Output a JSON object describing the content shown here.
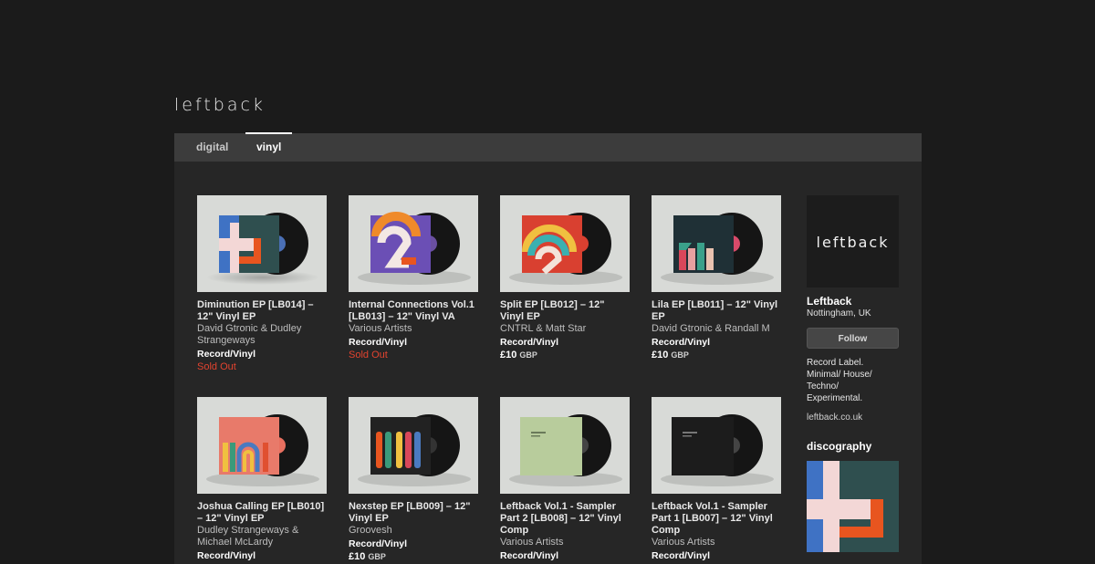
{
  "header": {
    "logo": "leftback"
  },
  "nav": {
    "tabs": [
      {
        "label": "digital"
      },
      {
        "label": "vinyl"
      }
    ]
  },
  "releases": [
    {
      "title": "Diminution EP [LB014] – 12\" Vinyl EP",
      "artist": "David Gtronic & Dudley Strangeways",
      "format": "Record/Vinyl",
      "status": "Sold Out"
    },
    {
      "title": "Internal Connections Vol.1 [LB013] – 12\" Vinyl VA",
      "artist": "Various Artists",
      "format": "Record/Vinyl",
      "status": "Sold Out"
    },
    {
      "title": "Split EP [LB012] – 12\" Vinyl EP",
      "artist": "CNTRL & Matt Star",
      "format": "Record/Vinyl",
      "price": "£10",
      "currency": "GBP"
    },
    {
      "title": "Lila EP [LB011] – 12\" Vinyl EP",
      "artist": "David Gtronic & Randall M",
      "format": "Record/Vinyl",
      "price": "£10",
      "currency": "GBP"
    },
    {
      "title": "Joshua Calling EP [LB010] – 12\" Vinyl EP",
      "artist": "Dudley Strangeways & Michael McLardy",
      "format": "Record/Vinyl"
    },
    {
      "title": "Nexstep EP [LB009] – 12\" Vinyl EP",
      "artist": "Groovesh",
      "format": "Record/Vinyl",
      "price": "£10",
      "currency": "GBP"
    },
    {
      "title": "Leftback Vol.1 - Sampler Part 2 [LB008] – 12\" Vinyl Comp",
      "artist": "Various Artists",
      "format": "Record/Vinyl"
    },
    {
      "title": "Leftback Vol.1 - Sampler Part 1 [LB007] – 12\" Vinyl Comp",
      "artist": "Various Artists",
      "format": "Record/Vinyl"
    }
  ],
  "sidebar": {
    "logo": "leftback",
    "name": "Leftback",
    "location": "Nottingham, UK",
    "follow_label": "Follow",
    "description": "Record Label. Minimal/ House/ Techno/ Experimental.",
    "link": "leftback.co.uk",
    "discography_label": "discography"
  },
  "colors": {
    "background": "#1b1b1b",
    "nav": "#3c3c3c",
    "panel": "#262626",
    "sold_out": "#e2432f"
  }
}
